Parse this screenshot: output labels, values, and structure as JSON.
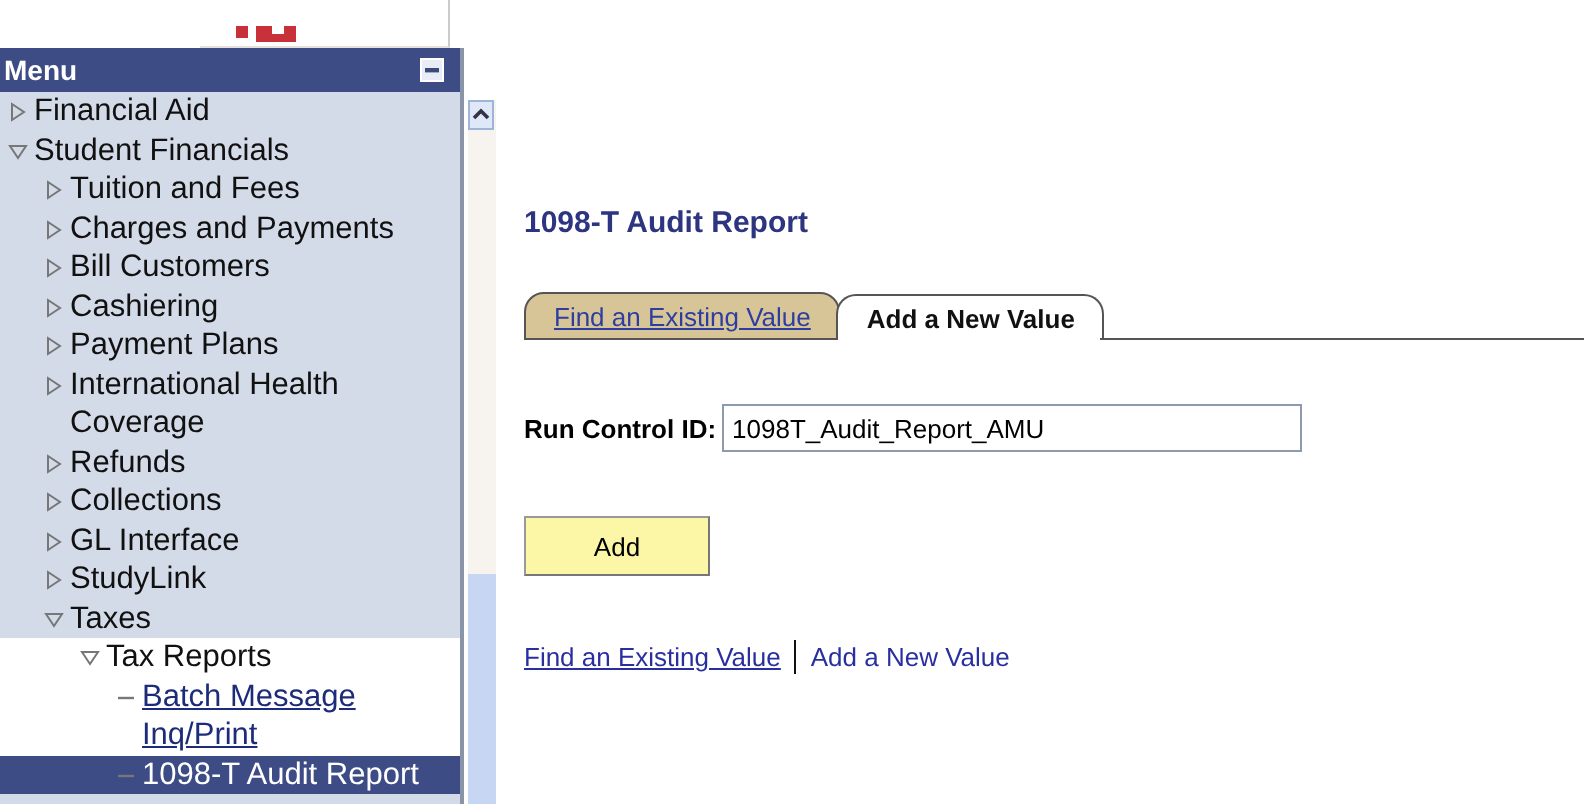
{
  "menu": {
    "title": "Menu",
    "items": [
      {
        "label": "Financial Aid",
        "kind": "folder",
        "expanded": false,
        "selected": false
      },
      {
        "label": "Student Financials",
        "kind": "folder",
        "expanded": true,
        "selected": false,
        "children": [
          {
            "label": "Tuition and Fees",
            "kind": "folder",
            "expanded": false,
            "selected": false
          },
          {
            "label": "Charges and Payments",
            "kind": "folder",
            "expanded": false,
            "selected": false
          },
          {
            "label": "Bill Customers",
            "kind": "folder",
            "expanded": false,
            "selected": false
          },
          {
            "label": "Cashiering",
            "kind": "folder",
            "expanded": false,
            "selected": false
          },
          {
            "label": "Payment Plans",
            "kind": "folder",
            "expanded": false,
            "selected": false
          },
          {
            "label": "International Health Coverage",
            "kind": "folder",
            "expanded": false,
            "selected": false
          },
          {
            "label": "Refunds",
            "kind": "folder",
            "expanded": false,
            "selected": false
          },
          {
            "label": "Collections",
            "kind": "folder",
            "expanded": false,
            "selected": false
          },
          {
            "label": "GL Interface",
            "kind": "folder",
            "expanded": false,
            "selected": false
          },
          {
            "label": "StudyLink",
            "kind": "folder",
            "expanded": false,
            "selected": false
          },
          {
            "label": "Taxes",
            "kind": "folder",
            "expanded": true,
            "selected": false,
            "children": [
              {
                "label": "Tax Reports",
                "kind": "folder",
                "expanded": true,
                "selected": false,
                "children": [
                  {
                    "label": "Batch Message Inq/Print",
                    "kind": "link",
                    "selected": false
                  },
                  {
                    "label": "1098-T Audit Report",
                    "kind": "link",
                    "selected": true
                  }
                ]
              }
            ]
          }
        ]
      }
    ]
  },
  "page": {
    "title": "1098-T Audit Report",
    "tabs": [
      {
        "label": "Find an Existing Value",
        "selected": false
      },
      {
        "label": "Add a New Value",
        "selected": true
      }
    ],
    "run_control": {
      "label": "Run Control ID:",
      "value": "1098T_Audit_Report_AMU"
    },
    "button": "Add",
    "links": [
      {
        "label": "Find an Existing Value",
        "selected": false
      },
      {
        "label": "Add a New Value",
        "selected": true
      }
    ]
  }
}
